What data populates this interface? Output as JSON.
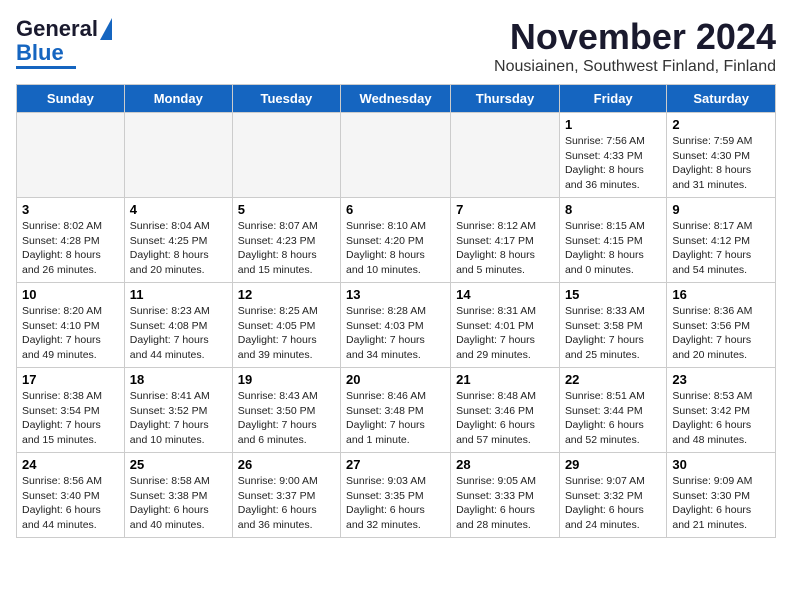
{
  "header": {
    "logo_line1": "General",
    "logo_line2": "Blue",
    "month": "November 2024",
    "location": "Nousiainen, Southwest Finland, Finland"
  },
  "days_of_week": [
    "Sunday",
    "Monday",
    "Tuesday",
    "Wednesday",
    "Thursday",
    "Friday",
    "Saturday"
  ],
  "weeks": [
    [
      {
        "day": "",
        "info": ""
      },
      {
        "day": "",
        "info": ""
      },
      {
        "day": "",
        "info": ""
      },
      {
        "day": "",
        "info": ""
      },
      {
        "day": "",
        "info": ""
      },
      {
        "day": "1",
        "info": "Sunrise: 7:56 AM\nSunset: 4:33 PM\nDaylight: 8 hours and 36 minutes."
      },
      {
        "day": "2",
        "info": "Sunrise: 7:59 AM\nSunset: 4:30 PM\nDaylight: 8 hours and 31 minutes."
      }
    ],
    [
      {
        "day": "3",
        "info": "Sunrise: 8:02 AM\nSunset: 4:28 PM\nDaylight: 8 hours and 26 minutes."
      },
      {
        "day": "4",
        "info": "Sunrise: 8:04 AM\nSunset: 4:25 PM\nDaylight: 8 hours and 20 minutes."
      },
      {
        "day": "5",
        "info": "Sunrise: 8:07 AM\nSunset: 4:23 PM\nDaylight: 8 hours and 15 minutes."
      },
      {
        "day": "6",
        "info": "Sunrise: 8:10 AM\nSunset: 4:20 PM\nDaylight: 8 hours and 10 minutes."
      },
      {
        "day": "7",
        "info": "Sunrise: 8:12 AM\nSunset: 4:17 PM\nDaylight: 8 hours and 5 minutes."
      },
      {
        "day": "8",
        "info": "Sunrise: 8:15 AM\nSunset: 4:15 PM\nDaylight: 8 hours and 0 minutes."
      },
      {
        "day": "9",
        "info": "Sunrise: 8:17 AM\nSunset: 4:12 PM\nDaylight: 7 hours and 54 minutes."
      }
    ],
    [
      {
        "day": "10",
        "info": "Sunrise: 8:20 AM\nSunset: 4:10 PM\nDaylight: 7 hours and 49 minutes."
      },
      {
        "day": "11",
        "info": "Sunrise: 8:23 AM\nSunset: 4:08 PM\nDaylight: 7 hours and 44 minutes."
      },
      {
        "day": "12",
        "info": "Sunrise: 8:25 AM\nSunset: 4:05 PM\nDaylight: 7 hours and 39 minutes."
      },
      {
        "day": "13",
        "info": "Sunrise: 8:28 AM\nSunset: 4:03 PM\nDaylight: 7 hours and 34 minutes."
      },
      {
        "day": "14",
        "info": "Sunrise: 8:31 AM\nSunset: 4:01 PM\nDaylight: 7 hours and 29 minutes."
      },
      {
        "day": "15",
        "info": "Sunrise: 8:33 AM\nSunset: 3:58 PM\nDaylight: 7 hours and 25 minutes."
      },
      {
        "day": "16",
        "info": "Sunrise: 8:36 AM\nSunset: 3:56 PM\nDaylight: 7 hours and 20 minutes."
      }
    ],
    [
      {
        "day": "17",
        "info": "Sunrise: 8:38 AM\nSunset: 3:54 PM\nDaylight: 7 hours and 15 minutes."
      },
      {
        "day": "18",
        "info": "Sunrise: 8:41 AM\nSunset: 3:52 PM\nDaylight: 7 hours and 10 minutes."
      },
      {
        "day": "19",
        "info": "Sunrise: 8:43 AM\nSunset: 3:50 PM\nDaylight: 7 hours and 6 minutes."
      },
      {
        "day": "20",
        "info": "Sunrise: 8:46 AM\nSunset: 3:48 PM\nDaylight: 7 hours and 1 minute."
      },
      {
        "day": "21",
        "info": "Sunrise: 8:48 AM\nSunset: 3:46 PM\nDaylight: 6 hours and 57 minutes."
      },
      {
        "day": "22",
        "info": "Sunrise: 8:51 AM\nSunset: 3:44 PM\nDaylight: 6 hours and 52 minutes."
      },
      {
        "day": "23",
        "info": "Sunrise: 8:53 AM\nSunset: 3:42 PM\nDaylight: 6 hours and 48 minutes."
      }
    ],
    [
      {
        "day": "24",
        "info": "Sunrise: 8:56 AM\nSunset: 3:40 PM\nDaylight: 6 hours and 44 minutes."
      },
      {
        "day": "25",
        "info": "Sunrise: 8:58 AM\nSunset: 3:38 PM\nDaylight: 6 hours and 40 minutes."
      },
      {
        "day": "26",
        "info": "Sunrise: 9:00 AM\nSunset: 3:37 PM\nDaylight: 6 hours and 36 minutes."
      },
      {
        "day": "27",
        "info": "Sunrise: 9:03 AM\nSunset: 3:35 PM\nDaylight: 6 hours and 32 minutes."
      },
      {
        "day": "28",
        "info": "Sunrise: 9:05 AM\nSunset: 3:33 PM\nDaylight: 6 hours and 28 minutes."
      },
      {
        "day": "29",
        "info": "Sunrise: 9:07 AM\nSunset: 3:32 PM\nDaylight: 6 hours and 24 minutes."
      },
      {
        "day": "30",
        "info": "Sunrise: 9:09 AM\nSunset: 3:30 PM\nDaylight: 6 hours and 21 minutes."
      }
    ]
  ]
}
